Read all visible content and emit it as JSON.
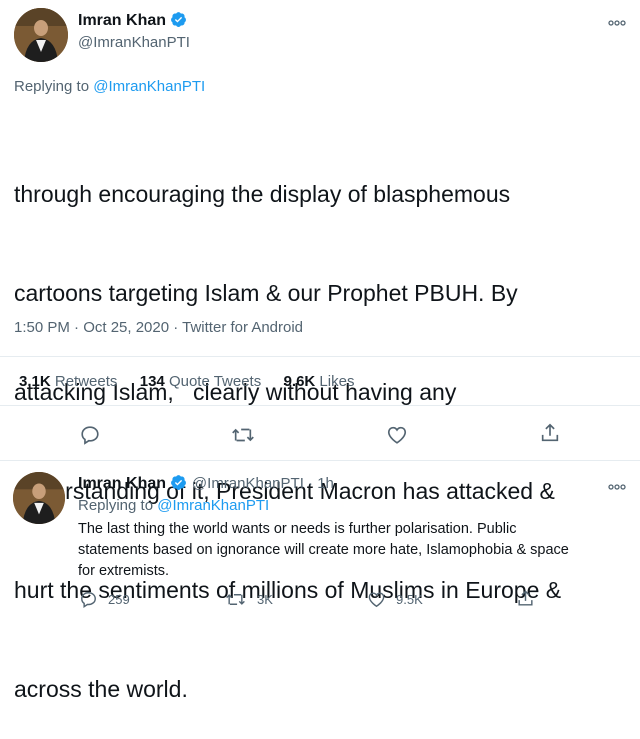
{
  "main_tweet": {
    "author_name": "Imran Khan",
    "author_handle": "@ImranKhanPTI",
    "replying_prefix": "Replying to",
    "replying_handle": "@ImranKhanPTI",
    "text_lines": [
      "through encouraging the display of blasphemous",
      "cartoons targeting Islam & our Prophet PBUH. By",
      "attacking Islam,   clearly without having any",
      "understanding of it, President Macron has attacked &",
      "hurt the sentiments of millions of Muslims in Europe &",
      "across the world."
    ],
    "timestamp": "1:50 PM · Oct 25, 2020 · Twitter for Android",
    "stats": {
      "retweets_count": "3.1K",
      "retweets_label": "Retweets",
      "quotes_count": "134",
      "quotes_label": "Quote Tweets",
      "likes_count": "9.6K",
      "likes_label": "Likes"
    },
    "actions": [
      "reply-icon",
      "retweet-icon",
      "like-icon",
      "share-icon"
    ]
  },
  "reply_tweet": {
    "author_name": "Imran Khan",
    "author_handle": "@ImranKhanPTI · 1h",
    "replying_prefix": "Replying to",
    "replying_handle": "@ImranKhanPTI",
    "text_lines": [
      "The last thing the world wants or needs is further polarisation. Public",
      "statements based on ignorance will create more hate, Islamophobia & space",
      "for extremists."
    ],
    "reply_count": "259",
    "retweet_count": "3K",
    "like_count": "9.5K"
  },
  "colors": {
    "accent": "#1d9bf0",
    "muted": "#536471",
    "divider": "#e6ecf0"
  }
}
